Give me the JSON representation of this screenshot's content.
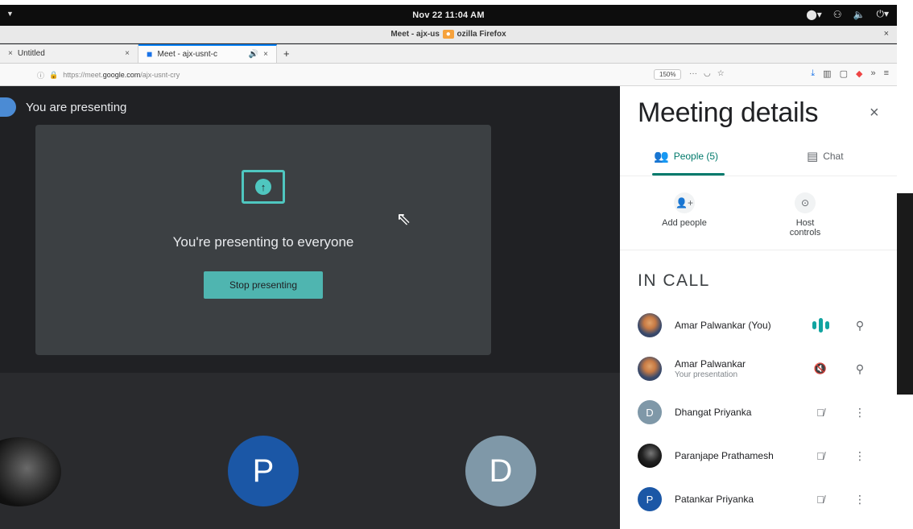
{
  "topbar": {
    "clock": "Nov 22  11:04 AM"
  },
  "window": {
    "title_left": "Meet - ajx-us",
    "title_right": "ozilla Firefox"
  },
  "tabs": [
    {
      "label": "Untitled"
    },
    {
      "label": "Meet - ajx-usnt-c"
    }
  ],
  "navbar": {
    "url_prefix": "https://meet.",
    "url_domain": "google.com",
    "url_path": "/ajx-usnt-cry",
    "zoom": "150%"
  },
  "meet": {
    "banner": "You are presenting",
    "message": "You're presenting to everyone",
    "stop_label": "Stop presenting",
    "tiles": [
      {
        "initial": "P",
        "color": "#1b57a6"
      },
      {
        "initial": "D",
        "color": "#7f98a8"
      }
    ]
  },
  "panel": {
    "title": "Meeting details",
    "tab_people": "People (5)",
    "tab_chat": "Chat",
    "add_people": "Add people",
    "host_controls": "Host controls",
    "section": "IN CALL",
    "participants": [
      {
        "name": "Amar Palwankar (You)",
        "sub": "",
        "avatar": "face"
      },
      {
        "name": "Amar Palwankar",
        "sub": "Your presentation",
        "avatar": "face"
      },
      {
        "name": "Dhangat Priyanka",
        "sub": "",
        "avatar": "D"
      },
      {
        "name": "Paranjape Prathamesh",
        "sub": "",
        "avatar": "dark"
      },
      {
        "name": "Patankar Priyanka",
        "sub": "",
        "avatar": "P"
      }
    ]
  },
  "colors": {
    "accent": "#4fb5b0",
    "people_tab": "#00796b",
    "meet_bg": "#202124"
  }
}
